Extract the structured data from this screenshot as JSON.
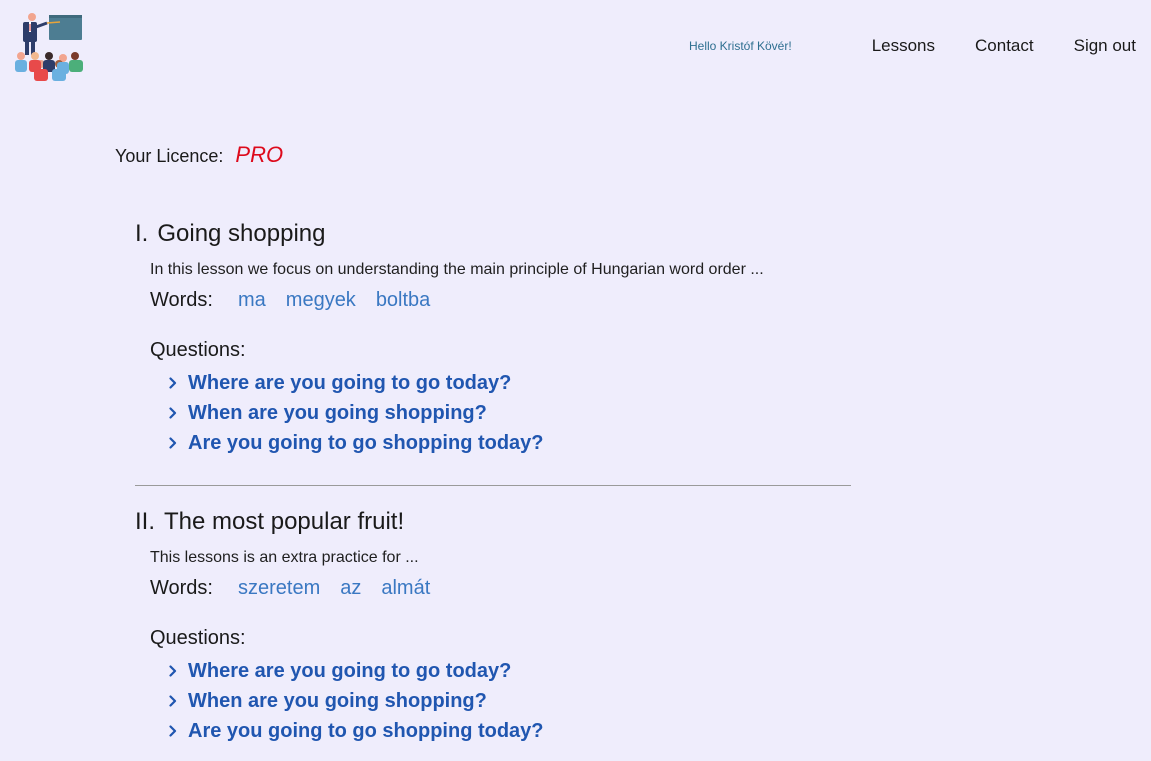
{
  "header": {
    "logo_icon": "teacher-classroom-icon",
    "greeting": "Hello Kristóf Kövér!",
    "nav": [
      {
        "label": "Lessons"
      },
      {
        "label": "Contact"
      },
      {
        "label": "Sign out"
      }
    ]
  },
  "licence": {
    "label": "Your Licence:",
    "value": "PRO",
    "value_color": "#dd0a1c"
  },
  "lessons": [
    {
      "number": "I.",
      "title": "Going shopping",
      "description": "In this lesson we focus on understanding the main principle of Hungarian word order ...",
      "words_label": "Words:",
      "words": [
        "ma",
        "megyek",
        "boltba"
      ],
      "questions_label": "Questions:",
      "questions": [
        "Where are you going to go today?",
        "When are you going shopping?",
        "Are you going to go shopping today?"
      ]
    },
    {
      "number": "II.",
      "title": "The most popular fruit!",
      "description": "This lessons is an extra practice for ...",
      "words_label": "Words:",
      "words": [
        "szeretem",
        "az",
        "almát"
      ],
      "questions_label": "Questions:",
      "questions": [
        "Where are you going to go today?",
        "When are you going shopping?",
        "Are you going to go shopping today?"
      ]
    }
  ],
  "colors": {
    "background": "#efedfc",
    "word_link": "#3a78c2",
    "question_link": "#2056b0",
    "greeting": "#2e6f90"
  }
}
